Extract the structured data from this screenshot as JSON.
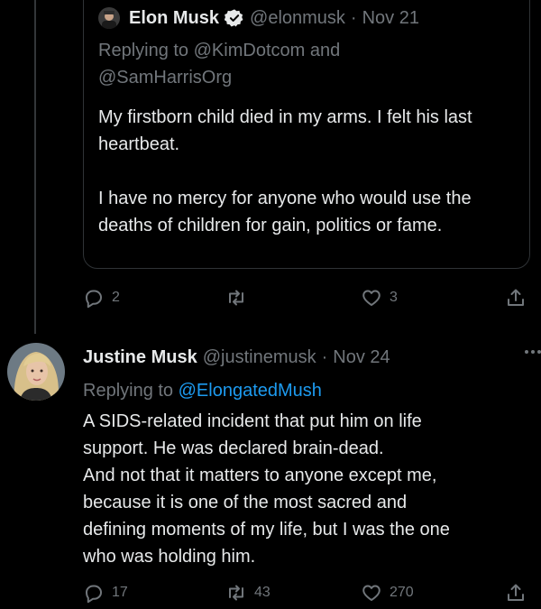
{
  "quoted_tweet": {
    "author_name": "Elon Musk",
    "handle": "@elonmusk",
    "separator": "·",
    "date": "Nov 21",
    "replying_prefix": "Replying to",
    "replying_handles_line1": "@KimDotcom and",
    "replying_handles_line2": "@SamHarrisOrg",
    "paragraphs": [
      "My firstborn child died in my arms. I felt his last heartbeat.",
      "I have no mercy for anyone who would use the deaths of children for gain, politics or fame."
    ],
    "verified": true
  },
  "quoted_actions": {
    "reply_count": "2",
    "retweet_count": "",
    "like_count": "3"
  },
  "reply_tweet": {
    "author_name": "Justine Musk",
    "handle": "@justinemusk",
    "separator": "·",
    "date": "Nov 24",
    "replying_prefix": "Replying to",
    "replying_handle": "@ElongatedMush",
    "lines": [
      "A SIDS-related incident that put him on life",
      "support. He was declared brain-dead.",
      "And not that it matters to anyone except me,",
      "because it is one of the most sacred and",
      "defining moments of my life, but I was the one",
      "who was holding him."
    ]
  },
  "reply_actions": {
    "reply_count": "17",
    "retweet_count": "43",
    "like_count": "270"
  },
  "icons": {
    "reply": "reply-icon",
    "retweet": "retweet-icon",
    "like": "heart-icon",
    "share": "share-icon",
    "more": "more-icon",
    "verified": "verified-badge-icon"
  },
  "colors": {
    "background": "#000000",
    "text": "#e7e9ea",
    "muted": "#71767b",
    "link": "#1d9bf0",
    "border": "#2f3336"
  }
}
